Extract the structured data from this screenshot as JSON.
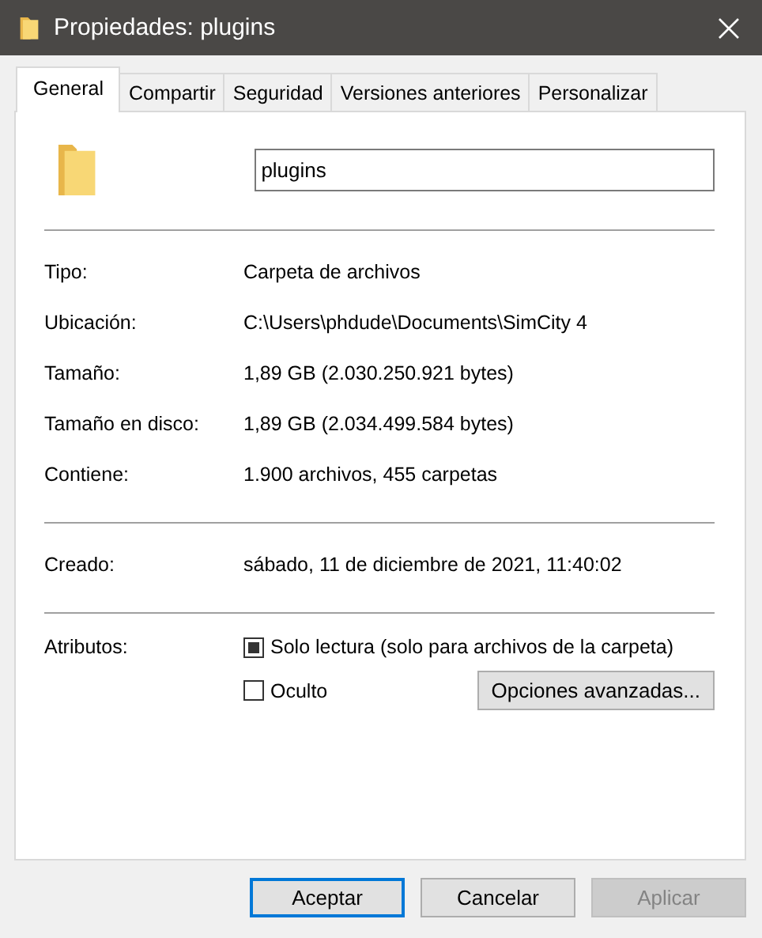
{
  "window": {
    "title": "Propiedades: plugins"
  },
  "tabs": [
    {
      "label": "General",
      "selected": true
    },
    {
      "label": "Compartir",
      "selected": false
    },
    {
      "label": "Seguridad",
      "selected": false
    },
    {
      "label": "Versiones anteriores",
      "selected": false
    },
    {
      "label": "Personalizar",
      "selected": false
    }
  ],
  "name_field": {
    "value": "plugins"
  },
  "info_groups": [
    [
      {
        "label": "Tipo:",
        "value": "Carpeta de archivos"
      },
      {
        "label": "Ubicación:",
        "value": "C:\\Users\\phdude\\Documents\\SimCity 4"
      },
      {
        "label": "Tamaño:",
        "value": "1,89 GB (2.030.250.921 bytes)"
      },
      {
        "label": "Tamaño en disco:",
        "value": "1,89 GB (2.034.499.584 bytes)"
      },
      {
        "label": "Contiene:",
        "value": "1.900 archivos, 455 carpetas"
      }
    ],
    [
      {
        "label": "Creado:",
        "value": "sábado, 11 de diciembre de 2021, 11:40:02"
      }
    ]
  ],
  "attributes": {
    "label": "Atributos:",
    "items": [
      {
        "label": "Solo lectura (solo para archivos de la carpeta)",
        "checked": false,
        "indeterminate": true
      },
      {
        "label": "Oculto",
        "checked": false,
        "indeterminate": false
      }
    ],
    "advanced_button": "Opciones avanzadas..."
  },
  "buttons": [
    {
      "label": "Aceptar",
      "default": true,
      "disabled": false
    },
    {
      "label": "Cancelar",
      "default": false,
      "disabled": false
    },
    {
      "label": "Aplicar",
      "default": false,
      "disabled": true
    }
  ]
}
